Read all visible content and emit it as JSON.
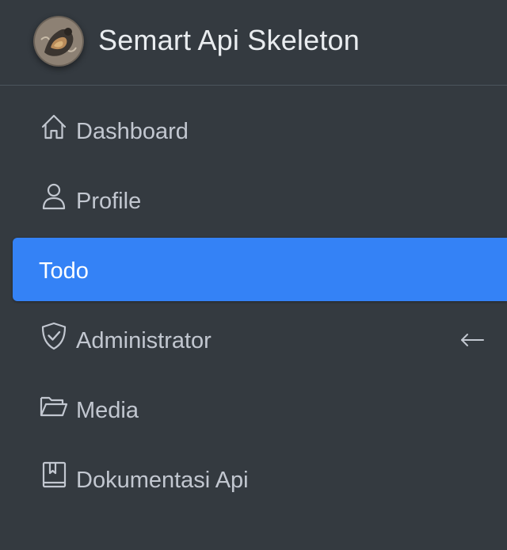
{
  "brand": {
    "title": "Semart Api Skeleton",
    "logo_icon": "avatar-logo"
  },
  "nav": {
    "items": [
      {
        "label": "Dashboard",
        "icon": "home-icon",
        "active": false
      },
      {
        "label": "Profile",
        "icon": "person-icon",
        "active": false
      },
      {
        "label": "Todo",
        "icon": "",
        "active": true
      },
      {
        "label": "Administrator",
        "icon": "shield-check-icon",
        "active": false,
        "expand_icon": "arrow-left-icon"
      },
      {
        "label": "Media",
        "icon": "folder-open-icon",
        "active": false
      },
      {
        "label": "Dokumentasi Api",
        "icon": "book-icon",
        "active": false
      }
    ]
  },
  "colors": {
    "sidebar_bg": "#343a40",
    "active_bg": "#3482f6",
    "text": "#c2c7d0",
    "divider": "#4b545c"
  }
}
